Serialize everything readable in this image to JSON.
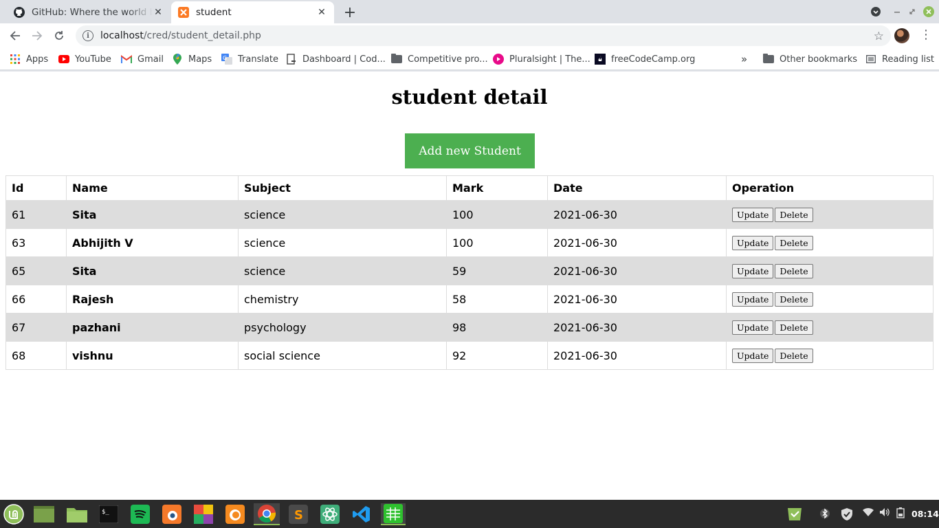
{
  "browser": {
    "tabs": [
      {
        "title": "GitHub: Where the world builds software"
      },
      {
        "title": "student"
      }
    ],
    "address": {
      "host": "localhost",
      "path": "/cred/student_detail.php"
    },
    "bookmarks": [
      {
        "label": "Apps"
      },
      {
        "label": "YouTube"
      },
      {
        "label": "Gmail"
      },
      {
        "label": "Maps"
      },
      {
        "label": "Translate"
      },
      {
        "label": "Dashboard | Cod..."
      },
      {
        "label": "Competitive pro..."
      },
      {
        "label": "Pluralsight | The..."
      },
      {
        "label": "freeCodeCamp.org"
      }
    ],
    "overflow": "»",
    "other_bookmarks": "Other bookmarks",
    "reading_list": "Reading list"
  },
  "page": {
    "title": "student detail",
    "add_button": "Add new Student",
    "columns": [
      "Id",
      "Name",
      "Subject",
      "Mark",
      "Date",
      "Operation"
    ],
    "rows": [
      {
        "id": "61",
        "name": "Sita",
        "subject": "science",
        "mark": "100",
        "date": "2021-06-30"
      },
      {
        "id": "63",
        "name": "Abhijith V",
        "subject": "science",
        "mark": "100",
        "date": "2021-06-30"
      },
      {
        "id": "65",
        "name": "Sita",
        "subject": "science",
        "mark": "59",
        "date": "2021-06-30"
      },
      {
        "id": "66",
        "name": "Rajesh",
        "subject": "chemistry",
        "mark": "58",
        "date": "2021-06-30"
      },
      {
        "id": "67",
        "name": "pazhani",
        "subject": "psychology",
        "mark": "98",
        "date": "2021-06-30"
      },
      {
        "id": "68",
        "name": "vishnu",
        "subject": "social science",
        "mark": "92",
        "date": "2021-06-30"
      }
    ],
    "update_label": "Update",
    "delete_label": "Delete"
  },
  "taskbar": {
    "clock": "08:14"
  },
  "colors": {
    "add_button_bg": "#4caf50",
    "row_stripe": "#dddddd"
  }
}
